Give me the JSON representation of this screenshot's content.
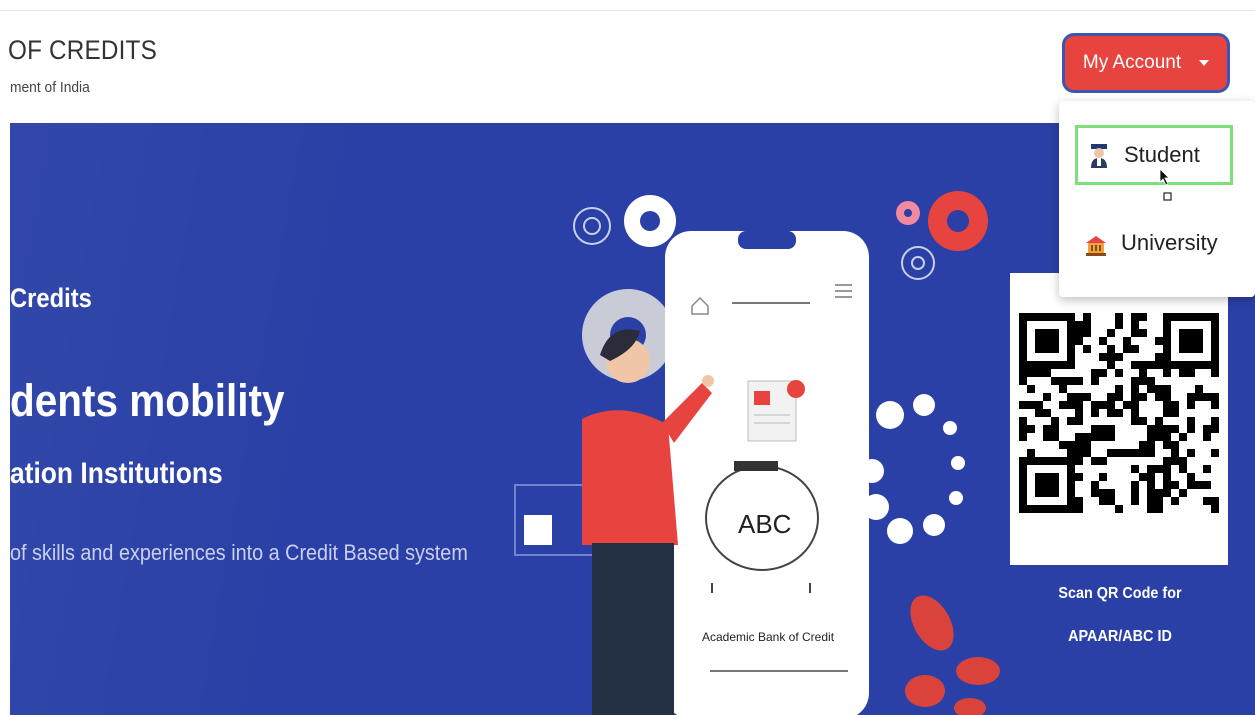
{
  "header": {
    "title": "OF CREDITS",
    "subtitle": "ment of India",
    "account_button": "My Account"
  },
  "dropdown": {
    "items": [
      {
        "label": "Student",
        "icon": "student-icon"
      },
      {
        "label": "University",
        "icon": "university-icon"
      }
    ]
  },
  "hero": {
    "line1": "Credits",
    "line2": "dents mobility",
    "line3": "ation Institutions",
    "line4": "of skills and experiences into a Credit Based system"
  },
  "phone": {
    "piggy_label": "ABC",
    "caption": "Academic Bank of Credit"
  },
  "qr": {
    "caption_line1": "Scan QR Code for",
    "caption_line2": "APAAR/ABC ID"
  },
  "colors": {
    "hero_bg": "#2a40a6",
    "account_button_bg": "#e8443f",
    "account_button_border": "#3a56b0",
    "selected_outline": "#7be07b"
  }
}
